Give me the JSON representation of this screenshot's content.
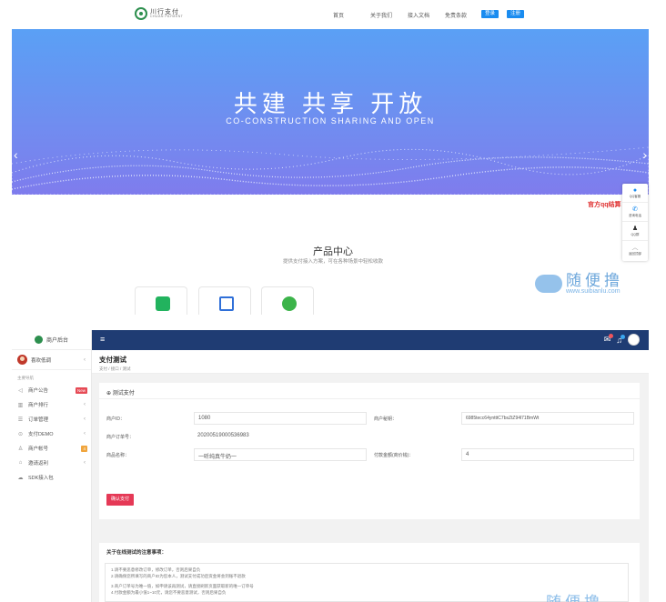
{
  "site": {
    "logo_cn": "川行支付",
    "logo_en": "CHUAN PAYMENT",
    "nav": [
      "首页",
      "关于我们",
      "接入文档",
      "免责条款"
    ],
    "login_label": "登录",
    "register_label": "注册",
    "hero_title": "共建  共享  开放",
    "hero_subtitle": "CO-CONSTRUCTION  SHARING  AND  OPEN",
    "product_title": "产品中心",
    "product_subtitle": "提供支付接入方案，可在各种场景中轻松收款",
    "float_items": [
      "QQ客服",
      "咨询电话",
      "QQ群",
      "返回顶部"
    ],
    "qq_tag": "官方qq结算",
    "watermark_cn": "随便撸",
    "watermark_url": "www.suibianlu.com"
  },
  "admin": {
    "brand": "商户后台",
    "user": "喜欢低调",
    "section": "主要导航",
    "menu": [
      {
        "label": "商户公告",
        "icon": "megaphone-icon",
        "badge": "New"
      },
      {
        "label": "商户排行",
        "icon": "chart-icon",
        "badge": ""
      },
      {
        "label": "订单管理",
        "icon": "list-icon",
        "badge": ""
      },
      {
        "label": "支付DEMO",
        "icon": "pay-icon",
        "badge": ""
      },
      {
        "label": "商户帐号",
        "icon": "user-icon",
        "badge": "4"
      },
      {
        "label": "邀请返利",
        "icon": "gift-icon",
        "badge": ""
      },
      {
        "label": "SDK接入包",
        "icon": "cloud-icon",
        "badge": ""
      }
    ],
    "page_title": "支付测试",
    "breadcrumb": "支付  /  接口  /  测试",
    "card_title": "⊕ 测试支付",
    "fields": {
      "merchant_id_label": "商户ID：",
      "merchant_id": "1080",
      "merchant_key_label": "商户秘钥：",
      "merchant_key": "6985tecc64yntttC7bsZtZ94l71BmWt",
      "order_no_label": "商户订单号：",
      "order_no": "20200519000536983",
      "product_label": "商品名称：",
      "product": "一听纯真牛奶一",
      "amount_label": "付款金额(商价钱)：",
      "amount": "4"
    },
    "pay_button": "确认支付",
    "notes_title": "关于在线测试的注意事项：",
    "notes": [
      "1.请不要恶意修改订单，修改订单，否则后果自负",
      "2.请确保您所填写的商户ID为您本人，测试支付成功后资金将会到账不退款",
      "3.商户订单号为唯一值，如申请该再测试，请直接刷新页面获取新的唯一订单号",
      "4.付款金额为最小值1~10元，请您不要恶意测试，否则后果自负"
    ],
    "watermark_cn": "随便撸"
  }
}
